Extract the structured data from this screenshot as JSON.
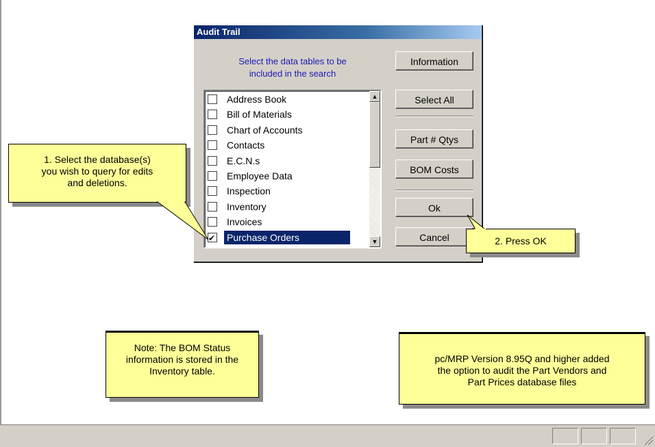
{
  "dialog": {
    "title": "Audit Trail",
    "prompt_line1": "Select the data tables to be",
    "prompt_line2": "included in the search",
    "list": [
      {
        "label": "Address Book",
        "checked": false,
        "selected": false
      },
      {
        "label": "Bill of Materials",
        "checked": false,
        "selected": false
      },
      {
        "label": "Chart of Accounts",
        "checked": false,
        "selected": false
      },
      {
        "label": "Contacts",
        "checked": false,
        "selected": false
      },
      {
        "label": "E.C.N.s",
        "checked": false,
        "selected": false
      },
      {
        "label": "Employee Data",
        "checked": false,
        "selected": false
      },
      {
        "label": "Inspection",
        "checked": false,
        "selected": false
      },
      {
        "label": "Inventory",
        "checked": false,
        "selected": false
      },
      {
        "label": "Invoices",
        "checked": false,
        "selected": false
      },
      {
        "label": "Purchase Orders",
        "checked": true,
        "selected": true
      }
    ],
    "buttons": {
      "information": "Information",
      "select_all": "Select All",
      "part_qtys": "Part # Qtys",
      "bom_costs": "BOM Costs",
      "ok": "Ok",
      "cancel": "Cancel"
    }
  },
  "callouts": {
    "step1_line1": "1. Select the database(s)",
    "step1_line2": "you wish to query for edits",
    "step1_line3": "and deletions.",
    "step2": "2.  Press OK",
    "note_line1": "Note: The BOM Status",
    "note_line2": "information is stored in the",
    "note_line3": "Inventory table.",
    "version_line1": "pc/MRP Version 8.95Q and higher added",
    "version_line2": "the option to audit the Part Vendors and",
    "version_line3": "Part Prices database files"
  },
  "colors": {
    "titlebar": "#0a246a",
    "prompt_text": "#1a1ab4",
    "callout_fill": "#ffff99",
    "dialog_face": "#d4d0c8"
  }
}
